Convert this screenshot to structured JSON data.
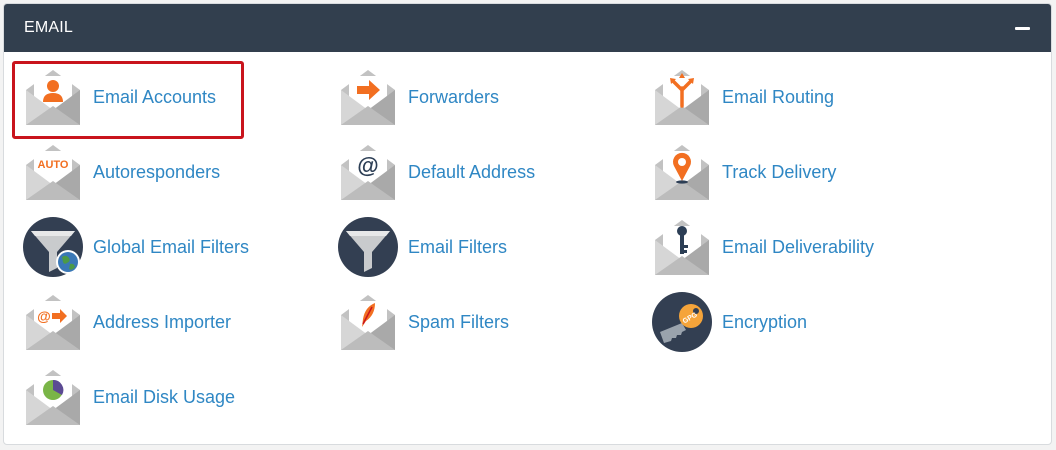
{
  "section": {
    "title": "EMAIL",
    "collapse_icon": "minus-icon"
  },
  "colors": {
    "header_bg": "#323f4e",
    "link": "#2f87c4",
    "accent_orange": "#f26f21",
    "highlight_border": "#c9141d",
    "envelope_gray": "#b3b3b3",
    "dark_circle": "#333f52"
  },
  "items": [
    {
      "label": "Email Accounts",
      "icon": "email-account-icon"
    },
    {
      "label": "Forwarders",
      "icon": "forward-arrow-icon"
    },
    {
      "label": "Email Routing",
      "icon": "routing-fork-icon"
    },
    {
      "label": "Autoresponders",
      "icon": "auto-badge-icon",
      "icon_text": "AUTO"
    },
    {
      "label": "Default Address",
      "icon": "at-sign-icon",
      "icon_text": "@"
    },
    {
      "label": "Track Delivery",
      "icon": "location-pin-icon"
    },
    {
      "label": "Global Email Filters",
      "icon": "funnel-globe-icon"
    },
    {
      "label": "Email Filters",
      "icon": "funnel-icon"
    },
    {
      "label": "Email Deliverability",
      "icon": "key-icon"
    },
    {
      "label": "Address Importer",
      "icon": "at-arrow-icon",
      "icon_text": "@"
    },
    {
      "label": "Spam Filters",
      "icon": "quill-icon"
    },
    {
      "label": "Encryption",
      "icon": "gpg-key-icon",
      "icon_text": "GPG"
    },
    {
      "label": "Email Disk Usage",
      "icon": "pie-chart-icon"
    }
  ]
}
